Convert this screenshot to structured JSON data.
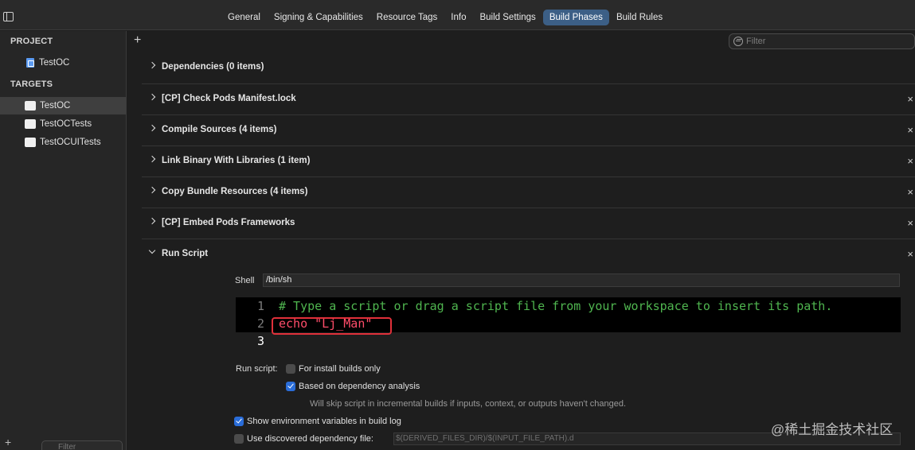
{
  "tabs": [
    {
      "label": "General"
    },
    {
      "label": "Signing & Capabilities"
    },
    {
      "label": "Resource Tags"
    },
    {
      "label": "Info"
    },
    {
      "label": "Build Settings"
    },
    {
      "label": "Build Phases"
    },
    {
      "label": "Build Rules"
    }
  ],
  "active_tab": "Build Phases",
  "navigator": {
    "project_header": "PROJECT",
    "project_item": "TestOC",
    "targets_header": "TARGETS",
    "targets": [
      {
        "label": "TestOC",
        "selected": true
      },
      {
        "label": "TestOCTests",
        "selected": false
      },
      {
        "label": "TestOCUITests",
        "selected": false
      }
    ],
    "add_label": "+",
    "filter_placeholder": "Filter"
  },
  "toolbar": {
    "add_label": "+",
    "filter_placeholder": "Filter"
  },
  "phases": [
    {
      "title": "Dependencies (0 items)",
      "removable": false,
      "expanded": false
    },
    {
      "title": "[CP] Check Pods Manifest.lock",
      "removable": true,
      "expanded": false
    },
    {
      "title": "Compile Sources (4 items)",
      "removable": true,
      "expanded": false
    },
    {
      "title": "Link Binary With Libraries (1 item)",
      "removable": true,
      "expanded": false
    },
    {
      "title": "Copy Bundle Resources (4 items)",
      "removable": true,
      "expanded": false
    },
    {
      "title": "[CP] Embed Pods Frameworks",
      "removable": true,
      "expanded": false
    },
    {
      "title": "Run Script",
      "removable": true,
      "expanded": true
    }
  ],
  "close_glyph": "×",
  "run_script": {
    "shell_label": "Shell",
    "shell_value": "/bin/sh",
    "lines": [
      {
        "number": "1",
        "text": "# Type a script or drag a script file from your workspace to insert its path."
      },
      {
        "number": "2",
        "text": "echo \"Lj_Man\""
      },
      {
        "number": "3",
        "text": ""
      }
    ],
    "run_script_label": "Run script:",
    "for_install_builds_label": "For install builds only",
    "for_install_builds_checked": false,
    "dependency_analysis_label": "Based on dependency analysis",
    "dependency_analysis_checked": true,
    "dependency_note": "Will skip script in incremental builds if inputs, context, or outputs haven't changed.",
    "show_env_label": "Show environment variables in build log",
    "show_env_checked": true,
    "dep_file_label": "Use discovered dependency file:",
    "dep_file_checked": false,
    "dep_file_placeholder": "$(DERIVED_FILES_DIR)/$(INPUT_FILE_PATH).d"
  },
  "watermark": "@稀土掘金技术社区",
  "colors": {
    "active_tab": "#3c5f86",
    "highlight_border": "#e0303a",
    "comment": "#4fb54f",
    "string": "#ff4d6a",
    "checkbox_checked": "#2a6dd9"
  }
}
